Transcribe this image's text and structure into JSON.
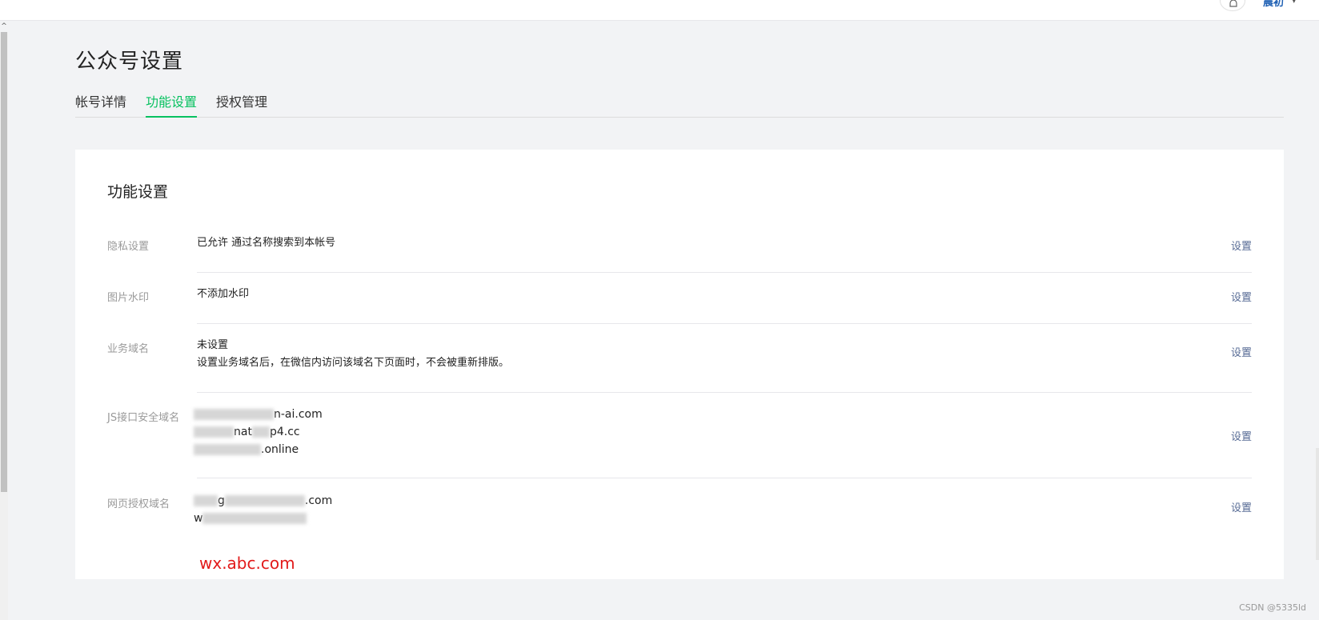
{
  "header": {
    "avatar_text": "晨初",
    "caret": "▾"
  },
  "page": {
    "title": "公众号设置",
    "tabs": [
      {
        "label": "帐号详情"
      },
      {
        "label": "功能设置"
      },
      {
        "label": "授权管理"
      }
    ]
  },
  "card": {
    "title": "功能设置",
    "rows": [
      {
        "label": "隐私设置",
        "value": "已允许 通过名称搜索到本帐号",
        "action": "设置"
      },
      {
        "label": "图片水印",
        "value": "不添加水印",
        "action": "设置"
      },
      {
        "label": "业务域名",
        "value": "未设置",
        "hint": "设置业务域名后，在微信内访问该域名下页面时，不会被重新排版。",
        "action": "设置"
      },
      {
        "label": "JS接口安全域名",
        "domains": [
          "n-ai.com",
          "nat",
          "p4.cc",
          ".online"
        ],
        "action": "设置"
      },
      {
        "label": "网页授权域名",
        "domains": [
          "g",
          ".com",
          "w"
        ],
        "action": "设置"
      }
    ],
    "annotation": "wx.abc.com"
  },
  "watermark": "CSDN @5335ld",
  "colors": {
    "accent_green": "#07c160",
    "link_blue": "#576b95",
    "annotation_red": "#e21a1a"
  }
}
